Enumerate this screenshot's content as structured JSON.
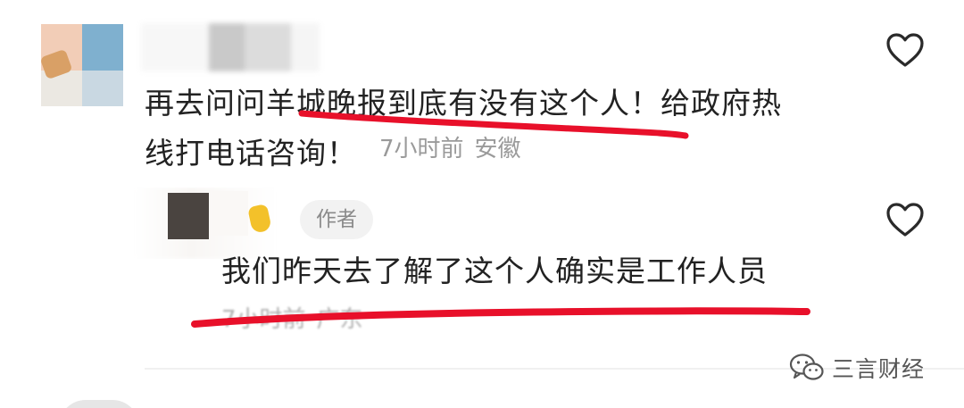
{
  "comments": [
    {
      "text_line1": "再去问问羊城晚报到底有没有这个人！给政府热",
      "text_line2": "线打电话咨询！",
      "time": "7小时前",
      "location": "安徽"
    }
  ],
  "reply": {
    "badge": "作者",
    "text": "我们昨天去了解了这个人确实是工作人员",
    "time": "7小时前",
    "location": "广东"
  },
  "watermark": {
    "label": "三言财经"
  },
  "colors": {
    "text": "#222222",
    "meta": "#9a9a9a",
    "badge_bg": "#f2f2f2",
    "highlight": "#e8102a"
  },
  "icons": {
    "like": "heart-outline-icon",
    "watermark": "wechat-icon"
  }
}
